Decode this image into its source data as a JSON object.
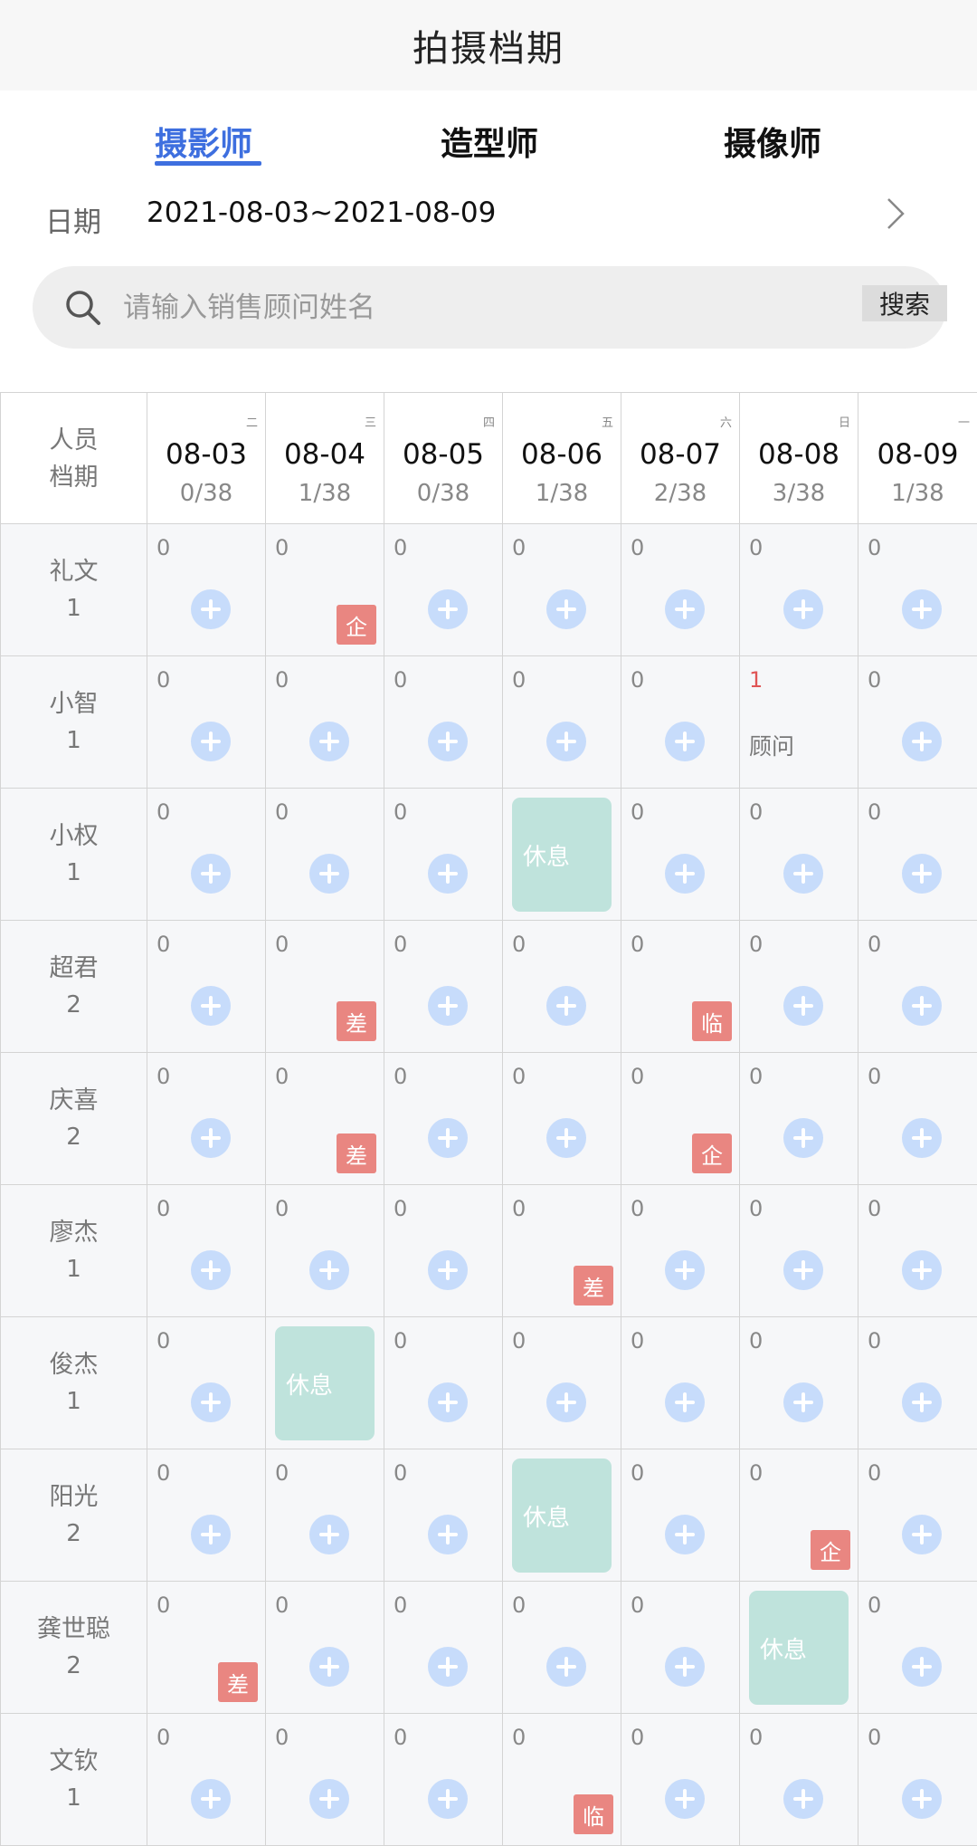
{
  "header": {
    "title": "拍摄档期"
  },
  "tabs": [
    {
      "label": "摄影师",
      "active": true
    },
    {
      "label": "造型师",
      "active": false
    },
    {
      "label": "摄像师",
      "active": false
    }
  ],
  "date": {
    "label": "日期",
    "range": "2021-08-03~2021-08-09"
  },
  "search": {
    "placeholder": "请输入销售顾问姓名",
    "button": "搜索"
  },
  "grid": {
    "corner_line1": "人员",
    "corner_line2": "档期",
    "days": [
      {
        "weekday": "二",
        "date": "08-03",
        "count": "0/38"
      },
      {
        "weekday": "三",
        "date": "08-04",
        "count": "1/38"
      },
      {
        "weekday": "四",
        "date": "08-05",
        "count": "0/38"
      },
      {
        "weekday": "五",
        "date": "08-06",
        "count": "1/38"
      },
      {
        "weekday": "六",
        "date": "08-07",
        "count": "2/38"
      },
      {
        "weekday": "日",
        "date": "08-08",
        "count": "3/38"
      },
      {
        "weekday": "一",
        "date": "08-09",
        "count": "1/38"
      }
    ],
    "rows": [
      {
        "name": "礼文",
        "num": "1",
        "cells": [
          {
            "count": "0"
          },
          {
            "count": "0",
            "tag": "企"
          },
          {
            "count": "0"
          },
          {
            "count": "0"
          },
          {
            "count": "0"
          },
          {
            "count": "0"
          },
          {
            "count": "0"
          }
        ]
      },
      {
        "name": "小智",
        "num": "1",
        "cells": [
          {
            "count": "0"
          },
          {
            "count": "0"
          },
          {
            "count": "0"
          },
          {
            "count": "0"
          },
          {
            "count": "0"
          },
          {
            "count": "1",
            "red": true,
            "note": "顾问"
          },
          {
            "count": "0"
          }
        ]
      },
      {
        "name": "小权",
        "num": "1",
        "cells": [
          {
            "count": "0"
          },
          {
            "count": "0"
          },
          {
            "count": "0"
          },
          {
            "rest": "休息"
          },
          {
            "count": "0"
          },
          {
            "count": "0"
          },
          {
            "count": "0"
          }
        ]
      },
      {
        "name": "超君",
        "num": "2",
        "cells": [
          {
            "count": "0"
          },
          {
            "count": "0",
            "tag": "差"
          },
          {
            "count": "0"
          },
          {
            "count": "0"
          },
          {
            "count": "0",
            "tag": "临"
          },
          {
            "count": "0"
          },
          {
            "count": "0"
          }
        ]
      },
      {
        "name": "庆喜",
        "num": "2",
        "cells": [
          {
            "count": "0"
          },
          {
            "count": "0",
            "tag": "差"
          },
          {
            "count": "0"
          },
          {
            "count": "0"
          },
          {
            "count": "0",
            "tag": "企"
          },
          {
            "count": "0"
          },
          {
            "count": "0"
          }
        ]
      },
      {
        "name": "廖杰",
        "num": "1",
        "cells": [
          {
            "count": "0"
          },
          {
            "count": "0"
          },
          {
            "count": "0"
          },
          {
            "count": "0",
            "tag": "差"
          },
          {
            "count": "0"
          },
          {
            "count": "0"
          },
          {
            "count": "0"
          }
        ]
      },
      {
        "name": "俊杰",
        "num": "1",
        "cells": [
          {
            "count": "0"
          },
          {
            "rest": "休息"
          },
          {
            "count": "0"
          },
          {
            "count": "0"
          },
          {
            "count": "0"
          },
          {
            "count": "0"
          },
          {
            "count": "0"
          }
        ]
      },
      {
        "name": "阳光",
        "num": "2",
        "cells": [
          {
            "count": "0"
          },
          {
            "count": "0"
          },
          {
            "count": "0"
          },
          {
            "rest": "休息"
          },
          {
            "count": "0"
          },
          {
            "count": "0",
            "tag": "企"
          },
          {
            "count": "0"
          }
        ]
      },
      {
        "name": "龚世聪",
        "num": "2",
        "cells": [
          {
            "count": "0",
            "tag": "差"
          },
          {
            "count": "0"
          },
          {
            "count": "0"
          },
          {
            "count": "0"
          },
          {
            "count": "0"
          },
          {
            "rest": "休息"
          },
          {
            "count": "0"
          }
        ]
      },
      {
        "name": "文钦",
        "num": "1",
        "cells": [
          {
            "count": "0"
          },
          {
            "count": "0"
          },
          {
            "count": "0"
          },
          {
            "count": "0",
            "tag": "临"
          },
          {
            "count": "0"
          },
          {
            "count": "0"
          },
          {
            "count": "0"
          }
        ]
      }
    ]
  },
  "colors": {
    "accent": "#3e6fdf",
    "tag": "#e98681",
    "rest": "#bfe3dc",
    "plus": "#c7dcfb",
    "red_count": "#e05555"
  }
}
